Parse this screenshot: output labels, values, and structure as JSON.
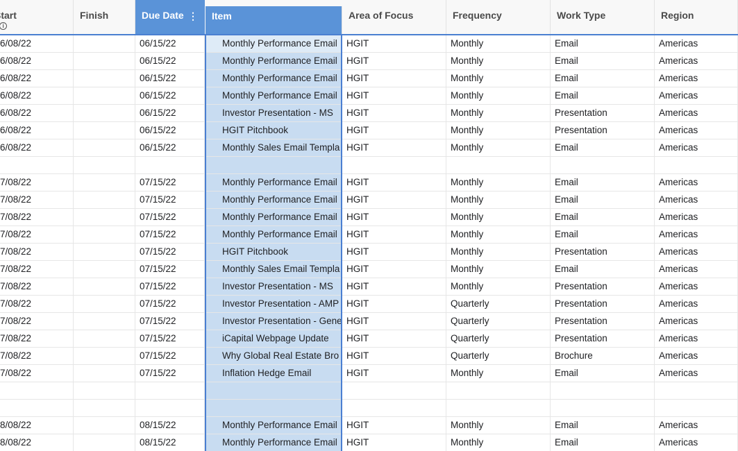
{
  "columns": {
    "start": "Start",
    "finish": "Finish",
    "due_date": "Due Date",
    "item": "Item",
    "area": "Area of Focus",
    "frequency": "Frequency",
    "work_type": "Work Type",
    "region": "Region"
  },
  "header_icons": {
    "kebab": "⋮",
    "info": "i"
  },
  "rows": [
    {
      "start": "6/08/22",
      "finish": "",
      "due": "06/15/22",
      "item": "Monthly Performance Email",
      "area": "HGIT",
      "freq": "Monthly",
      "type": "Email",
      "region": "Americas"
    },
    {
      "start": "6/08/22",
      "finish": "",
      "due": "06/15/22",
      "item": "Monthly Performance Email",
      "area": "HGIT",
      "freq": "Monthly",
      "type": "Email",
      "region": "Americas"
    },
    {
      "start": "6/08/22",
      "finish": "",
      "due": "06/15/22",
      "item": "Monthly Performance Email",
      "area": "HGIT",
      "freq": "Monthly",
      "type": "Email",
      "region": "Americas"
    },
    {
      "start": "6/08/22",
      "finish": "",
      "due": "06/15/22",
      "item": "Monthly Performance Email",
      "area": "HGIT",
      "freq": "Monthly",
      "type": "Email",
      "region": "Americas"
    },
    {
      "start": "6/08/22",
      "finish": "",
      "due": "06/15/22",
      "item": "Investor Presentation - MS",
      "area": "HGIT",
      "freq": "Monthly",
      "type": "Presentation",
      "region": "Americas"
    },
    {
      "start": "6/08/22",
      "finish": "",
      "due": "06/15/22",
      "item": "HGIT Pitchbook",
      "area": "HGIT",
      "freq": "Monthly",
      "type": "Presentation",
      "region": "Americas"
    },
    {
      "start": "6/08/22",
      "finish": "",
      "due": "06/15/22",
      "item": "Monthly Sales Email Templa",
      "area": "HGIT",
      "freq": "Monthly",
      "type": "Email",
      "region": "Americas"
    },
    {
      "start": "",
      "finish": "",
      "due": "",
      "item": "",
      "area": "",
      "freq": "",
      "type": "",
      "region": ""
    },
    {
      "start": "7/08/22",
      "finish": "",
      "due": "07/15/22",
      "item": "Monthly Performance Email",
      "area": "HGIT",
      "freq": "Monthly",
      "type": "Email",
      "region": "Americas"
    },
    {
      "start": "7/08/22",
      "finish": "",
      "due": "07/15/22",
      "item": "Monthly Performance Email",
      "area": "HGIT",
      "freq": "Monthly",
      "type": "Email",
      "region": "Americas"
    },
    {
      "start": "7/08/22",
      "finish": "",
      "due": "07/15/22",
      "item": "Monthly Performance Email",
      "area": "HGIT",
      "freq": "Monthly",
      "type": "Email",
      "region": "Americas"
    },
    {
      "start": "7/08/22",
      "finish": "",
      "due": "07/15/22",
      "item": "Monthly Performance Email",
      "area": "HGIT",
      "freq": "Monthly",
      "type": "Email",
      "region": "Americas"
    },
    {
      "start": "7/08/22",
      "finish": "",
      "due": "07/15/22",
      "item": "HGIT Pitchbook",
      "area": "HGIT",
      "freq": "Monthly",
      "type": "Presentation",
      "region": "Americas"
    },
    {
      "start": "7/08/22",
      "finish": "",
      "due": "07/15/22",
      "item": "Monthly Sales Email Templa",
      "area": "HGIT",
      "freq": "Monthly",
      "type": "Email",
      "region": "Americas"
    },
    {
      "start": "7/08/22",
      "finish": "",
      "due": "07/15/22",
      "item": "Investor Presentation - MS",
      "area": "HGIT",
      "freq": "Monthly",
      "type": "Presentation",
      "region": "Americas"
    },
    {
      "start": "7/08/22",
      "finish": "",
      "due": "07/15/22",
      "item": "Investor Presentation - AMP",
      "area": "HGIT",
      "freq": "Quarterly",
      "type": "Presentation",
      "region": "Americas"
    },
    {
      "start": "7/08/22",
      "finish": "",
      "due": "07/15/22",
      "item": "Investor Presentation - Gene",
      "area": "HGIT",
      "freq": "Quarterly",
      "type": "Presentation",
      "region": "Americas"
    },
    {
      "start": "7/08/22",
      "finish": "",
      "due": "07/15/22",
      "item": "iCapital Webpage Update",
      "area": "HGIT",
      "freq": "Quarterly",
      "type": "Presentation",
      "region": "Americas"
    },
    {
      "start": "7/08/22",
      "finish": "",
      "due": "07/15/22",
      "item": "Why Global Real Estate Bro",
      "area": "HGIT",
      "freq": "Quarterly",
      "type": "Brochure",
      "region": "Americas"
    },
    {
      "start": "7/08/22",
      "finish": "",
      "due": "07/15/22",
      "item": "Inflation Hedge Email",
      "area": "HGIT",
      "freq": "Monthly",
      "type": "Email",
      "region": "Americas"
    },
    {
      "start": "",
      "finish": "",
      "due": "",
      "item": "",
      "area": "",
      "freq": "",
      "type": "",
      "region": ""
    },
    {
      "start": "",
      "finish": "",
      "due": "",
      "item": "",
      "area": "",
      "freq": "",
      "type": "",
      "region": ""
    },
    {
      "start": "8/08/22",
      "finish": "",
      "due": "08/15/22",
      "item": "Monthly Performance Email",
      "area": "HGIT",
      "freq": "Monthly",
      "type": "Email",
      "region": "Americas"
    },
    {
      "start": "8/08/22",
      "finish": "",
      "due": "08/15/22",
      "item": "Monthly Performance Email",
      "area": "HGIT",
      "freq": "Monthly",
      "type": "Email",
      "region": "Americas"
    }
  ]
}
